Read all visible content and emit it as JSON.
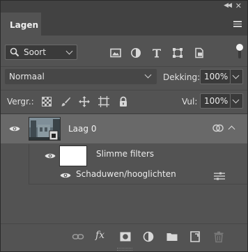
{
  "panel": {
    "title": "Lagen"
  },
  "filter": {
    "kind_label": "Soort"
  },
  "blend": {
    "mode": "Normaal",
    "opacity_label": "Dekking:",
    "opacity_value": "100%"
  },
  "lock": {
    "label": "Vergr.:",
    "fill_label": "Vul:",
    "fill_value": "100%"
  },
  "layers": [
    {
      "name": "Laag 0",
      "visible": true,
      "smart_object": true,
      "smart_filters_label": "Slimme filters",
      "filters": [
        {
          "name": "Schaduwen/hooglichten"
        }
      ]
    }
  ],
  "footer": {
    "fx_label": "fx"
  },
  "icons": {
    "filter_icons": [
      "image-filter-icon",
      "adjustment-filter-icon",
      "type-filter-icon",
      "shape-filter-icon",
      "smart-object-filter-icon"
    ],
    "lock_icons": [
      "lock-transparent-pixels-icon",
      "lock-image-pixels-icon",
      "lock-position-icon",
      "lock-artboard-icon",
      "lock-all-icon"
    ],
    "footer_icons": [
      "link-layers-icon",
      "fx-icon",
      "add-mask-icon",
      "new-adjustment-icon",
      "new-group-icon",
      "new-layer-icon",
      "trash-icon"
    ]
  },
  "colors": {
    "panel_bg": "#535353",
    "selected_layer_bg": "#696969",
    "header_bg": "#424242"
  }
}
